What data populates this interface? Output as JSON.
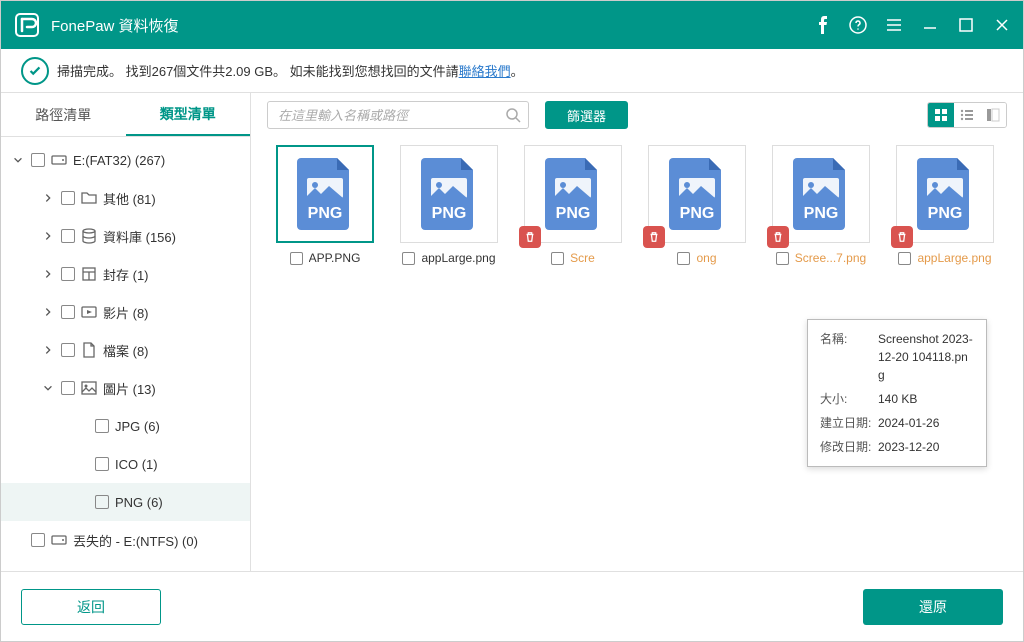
{
  "app": {
    "title": "FonePaw 資料恢復"
  },
  "status": {
    "text1": "掃描完成。 找到267個文件共2.09 GB。 如未能找到您想找回的文件請",
    "link": "聯絡我們",
    "text2": "。"
  },
  "sidebar": {
    "tabs": [
      "路徑清單",
      "類型清單"
    ],
    "tree": [
      {
        "level": 1,
        "icon": "drive",
        "label": "E:(FAT32) (267)",
        "chev": "down"
      },
      {
        "level": 2,
        "icon": "folder",
        "label": "其他 (81)",
        "chev": "right"
      },
      {
        "level": 2,
        "icon": "database",
        "label": "資料庫  (156)",
        "chev": "right"
      },
      {
        "level": 2,
        "icon": "archive",
        "label": "封存 (1)",
        "chev": "right"
      },
      {
        "level": 2,
        "icon": "video",
        "label": "影片 (8)",
        "chev": "right"
      },
      {
        "level": 2,
        "icon": "doc",
        "label": "檔案 (8)",
        "chev": "right"
      },
      {
        "level": 2,
        "icon": "image",
        "label": "圖片 (13)",
        "chev": "down"
      },
      {
        "level": 3,
        "icon": "",
        "label": "JPG (6)"
      },
      {
        "level": 3,
        "icon": "",
        "label": "ICO (1)"
      },
      {
        "level": 3,
        "icon": "",
        "label": "PNG (6)",
        "selected": true
      },
      {
        "level": 1,
        "icon": "drive",
        "label": "丟失的 - E:(NTFS) (0)",
        "chev": ""
      }
    ]
  },
  "toolbar": {
    "search_placeholder": "在這里輸入名稱或路徑",
    "filter_label": "篩選器"
  },
  "files": [
    {
      "name": "APP.PNG",
      "selected": true,
      "deleted": false
    },
    {
      "name": "appLarge.png",
      "selected": false,
      "deleted": false
    },
    {
      "name": "Scre",
      "selected": false,
      "deleted": true
    },
    {
      "name": "ong",
      "selected": false,
      "deleted": true
    },
    {
      "name": "Scree...7.png",
      "selected": false,
      "deleted": true
    },
    {
      "name": "appLarge.png",
      "selected": false,
      "deleted": true
    }
  ],
  "tooltip": {
    "name_label": "名稱:",
    "name_val": "Screenshot 2023-12-20 104118.png",
    "size_label": "大小:",
    "size_val": "140 KB",
    "created_label": "建立日期:",
    "created_val": "2024-01-26",
    "modified_label": "修改日期:",
    "modified_val": "2023-12-20"
  },
  "footer": {
    "back": "返回",
    "restore": "還原"
  }
}
